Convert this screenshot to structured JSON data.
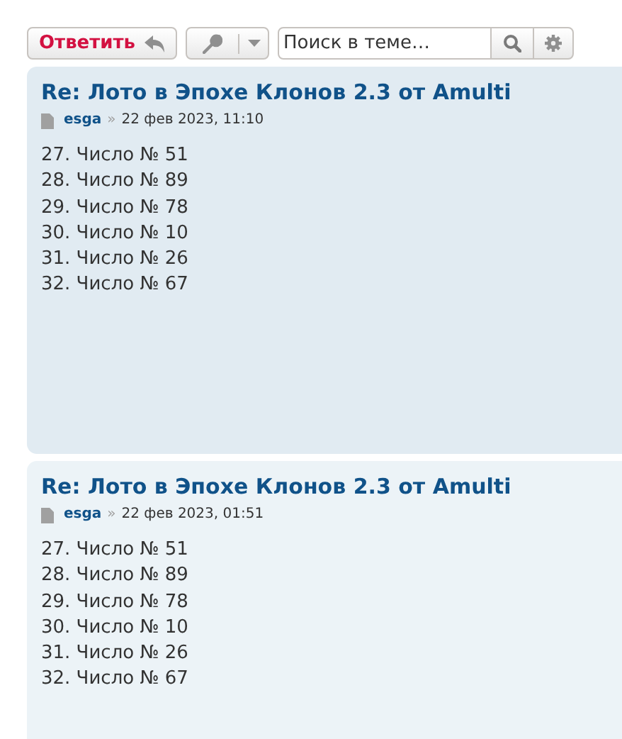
{
  "toolbar": {
    "reply_button": "Ответить",
    "search": {
      "placeholder": "Поиск в теме…"
    }
  },
  "posts": [
    {
      "kind": "odd",
      "title": "Re: Лото в Эпохе Клонов 2.3 от Amulti",
      "author": "esga",
      "separator": "»",
      "date": "22 фев 2023, 11:10",
      "lines": [
        "27. Число № 51",
        "28. Число № 89",
        "29. Число № 78",
        "30. Число № 10",
        "31. Число № 26",
        "32. Число № 67"
      ]
    },
    {
      "kind": "even",
      "title": "Re: Лото в Эпохе Клонов 2.3 от Amulti",
      "author": "esga",
      "separator": "»",
      "date": "22 фев 2023, 01:51",
      "lines": [
        "27. Число № 51",
        "28. Число № 89",
        "29. Число № 78",
        "30. Число № 10",
        "31. Число № 26",
        "32. Число № 67"
      ]
    }
  ]
}
